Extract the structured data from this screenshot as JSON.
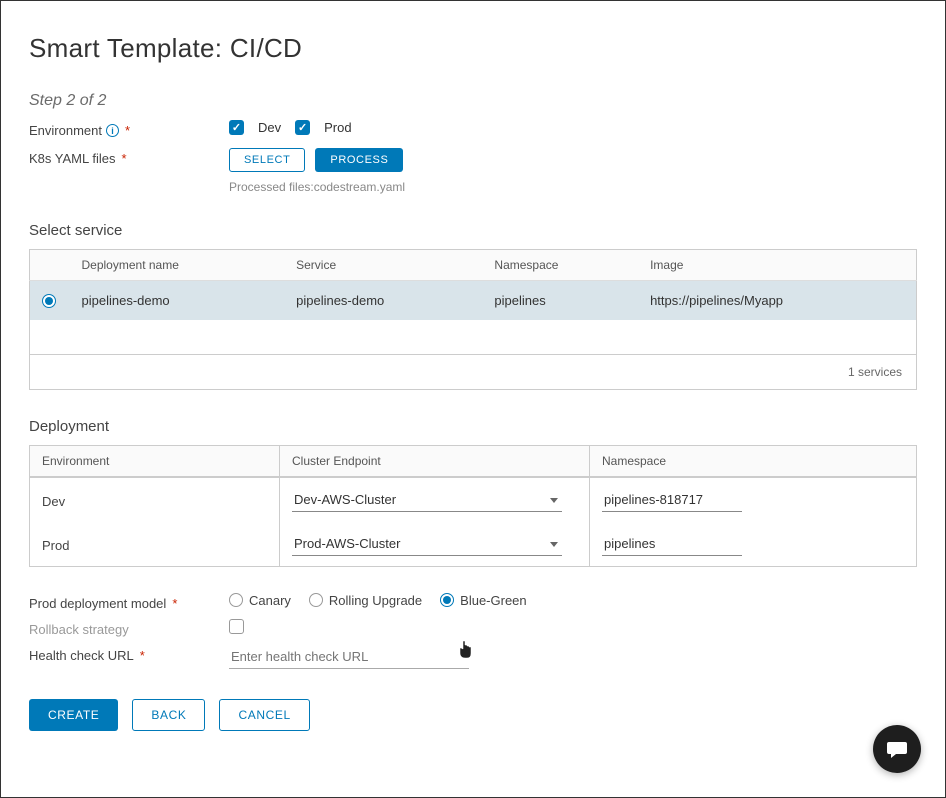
{
  "title": "Smart Template: CI/CD",
  "step": "Step 2 of 2",
  "labels": {
    "environment": "Environment",
    "k8s": "K8s YAML files",
    "select_service": "Select service",
    "deployment": "Deployment",
    "prod_model": "Prod deployment model",
    "rollback": "Rollback strategy",
    "health": "Health check URL"
  },
  "env": {
    "dev_checked": true,
    "dev_label": "Dev",
    "prod_checked": true,
    "prod_label": "Prod"
  },
  "k8s_buttons": {
    "select": "SELECT",
    "process": "PROCESS",
    "processed_note": "Processed files:codestream.yaml"
  },
  "service_table": {
    "headers": {
      "name": "Deployment name",
      "service": "Service",
      "namespace": "Namespace",
      "image": "Image"
    },
    "rows": [
      {
        "selected": true,
        "name": "pipelines-demo",
        "service": "pipelines-demo",
        "namespace": "pipelines",
        "image": "https://pipelines/Myapp"
      }
    ],
    "footer": "1 services"
  },
  "deployment_table": {
    "headers": {
      "env": "Environment",
      "cluster": "Cluster Endpoint",
      "ns": "Namespace"
    },
    "rows": [
      {
        "env": "Dev",
        "cluster": "Dev-AWS-Cluster",
        "ns": "pipelines-818717"
      },
      {
        "env": "Prod",
        "cluster": "Prod-AWS-Cluster",
        "ns": "pipelines"
      }
    ]
  },
  "prod_model": {
    "options": [
      {
        "label": "Canary",
        "selected": false
      },
      {
        "label": "Rolling Upgrade",
        "selected": false
      },
      {
        "label": "Blue-Green",
        "selected": true
      }
    ]
  },
  "rollback_checked": false,
  "health_placeholder": "Enter health check URL",
  "footer": {
    "create": "CREATE",
    "back": "BACK",
    "cancel": "CANCEL"
  }
}
